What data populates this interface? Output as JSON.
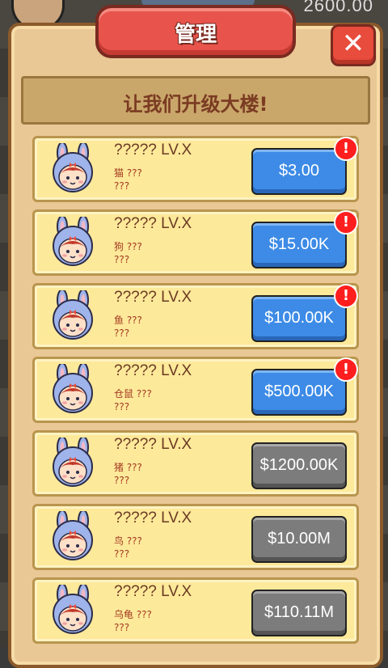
{
  "background": {
    "coins": "2600.00"
  },
  "panel": {
    "title": "管理",
    "close_label": "✕",
    "banner": "让我们升级大楼!"
  },
  "colors": {
    "accent_red": "#e8544c",
    "buy_blue": "#3d8be6",
    "locked_gray": "#7c7c7c"
  },
  "items": [
    {
      "name": "????? LV.X",
      "animal": "猫 ???",
      "sub": "???",
      "price": "$3.00",
      "state": "blue",
      "alert": "!"
    },
    {
      "name": "????? LV.X",
      "animal": "狗 ???",
      "sub": "???",
      "price": "$15.00K",
      "state": "blue",
      "alert": "!"
    },
    {
      "name": "????? LV.X",
      "animal": "鱼 ???",
      "sub": "???",
      "price": "$100.00K",
      "state": "blue",
      "alert": "!"
    },
    {
      "name": "????? LV.X",
      "animal": "仓鼠 ???",
      "sub": "???",
      "price": "$500.00K",
      "state": "blue",
      "alert": "!"
    },
    {
      "name": "????? LV.X",
      "animal": "猪 ???",
      "sub": "???",
      "price": "$1200.00K",
      "state": "gray",
      "alert": ""
    },
    {
      "name": "????? LV.X",
      "animal": "鸟 ???",
      "sub": "???",
      "price": "$10.00M",
      "state": "gray",
      "alert": ""
    },
    {
      "name": "????? LV.X",
      "animal": "乌龟 ???",
      "sub": "???",
      "price": "$110.11M",
      "state": "gray",
      "alert": ""
    }
  ]
}
